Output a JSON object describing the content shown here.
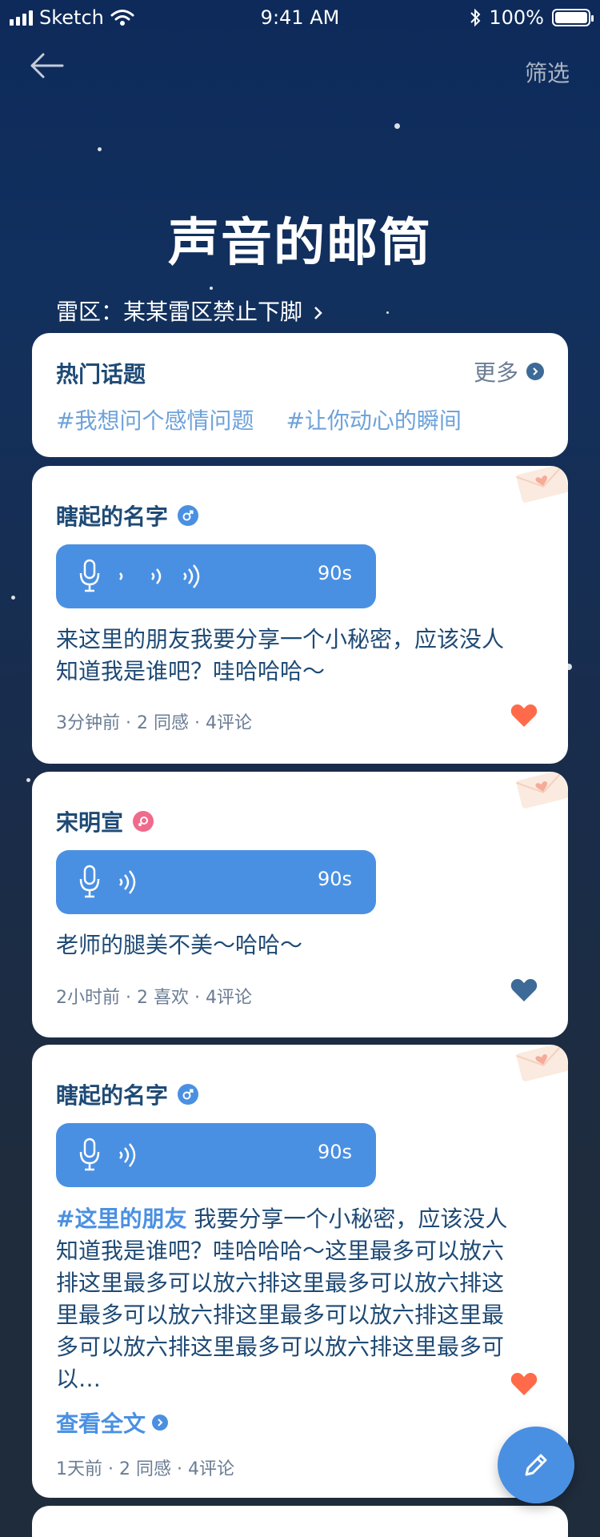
{
  "status_bar": {
    "carrier": "Sketch",
    "time": "9:41 AM",
    "battery": "100%"
  },
  "nav": {
    "filter_label": "筛选"
  },
  "title": "声音的邮筒",
  "mine_zone": "雷区：某某雷区禁止下脚",
  "hot_topics": {
    "title": "热门话题",
    "more_label": "更多",
    "tags": [
      "#我想问个感情问题",
      "#让你动心的瞬间"
    ]
  },
  "posts": [
    {
      "name": "瞎起的名字",
      "gender": "male",
      "duration": "90s",
      "text": "来这里的朋友我要分享一个小秘密，应该没人知道我是谁吧？哇哈哈哈～",
      "meta": "3分钟前 · 2 同感 · 4评论",
      "heart_color": "#ff6b4a"
    },
    {
      "name": "宋明宣",
      "gender": "female",
      "duration": "90s",
      "text": "老师的腿美不美～哈哈～",
      "meta": "2小时前 · 2 喜欢 · 4评论",
      "heart_color": "#3d6a97"
    },
    {
      "name": "瞎起的名字",
      "gender": "male",
      "duration": "90s",
      "hashtag": "#这里的朋友",
      "text": "我要分享一个小秘密，应该没人知道我是谁吧？哇哈哈哈～这里最多可以放六排这里最多可以放六排这里最多可以放六排这里最多可以放六排这里最多可以放六排这里最多可以放六排这里最多可以放六排这里最多可以…",
      "read_more": "查看全文",
      "meta": "1天前 · 2 同感 · 4评论",
      "heart_color": "#ff6b4a"
    }
  ],
  "colors": {
    "accent": "#4a90e2",
    "heart_active": "#ff6b4a",
    "heart_inactive": "#3d6a97",
    "text_dark": "#1e4a75"
  }
}
